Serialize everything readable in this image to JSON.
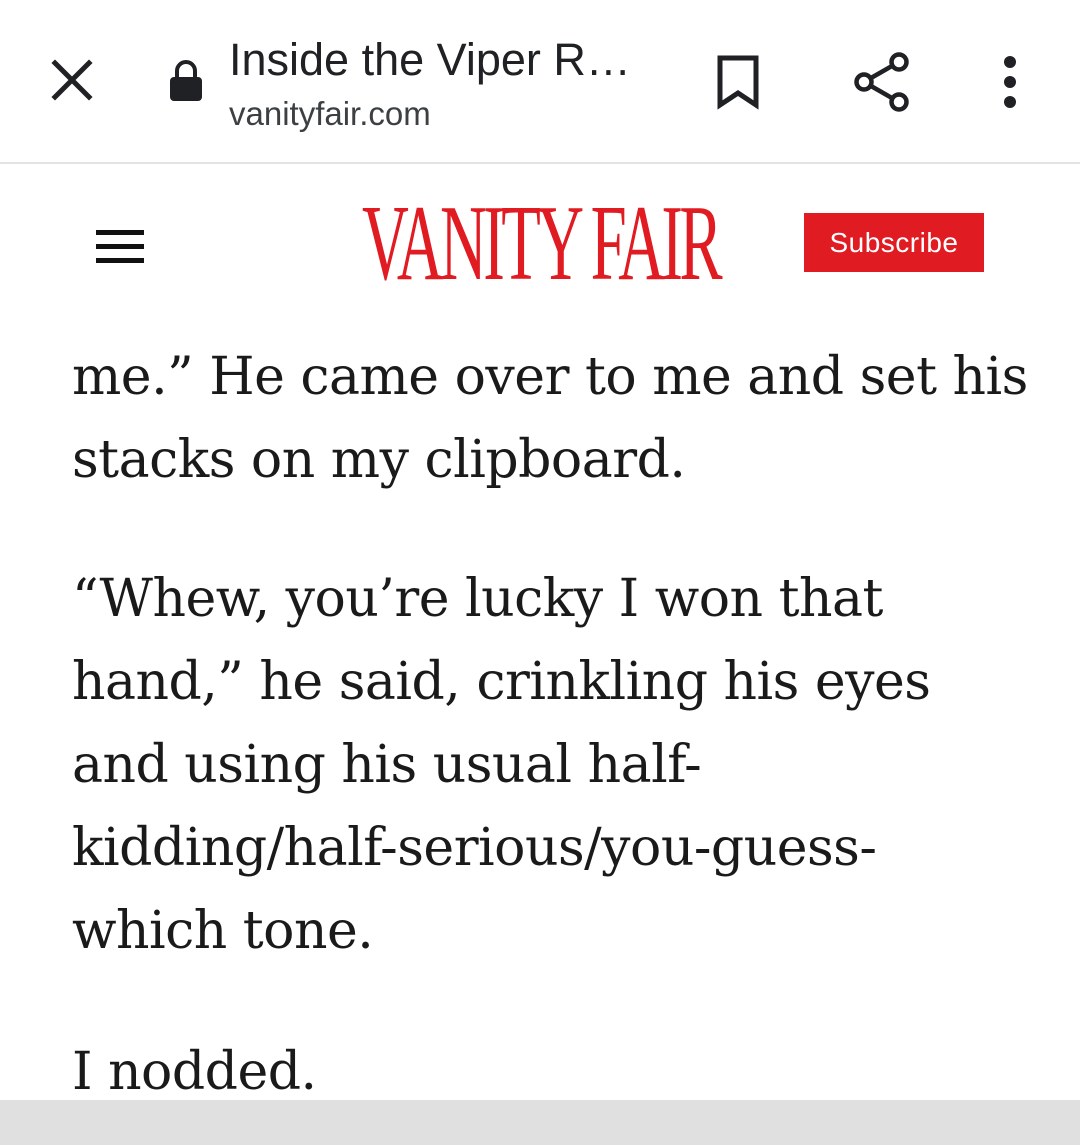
{
  "browser": {
    "page_title": "Inside the Viper R…",
    "domain": "vanityfair.com",
    "icons": {
      "close": "close-icon",
      "lock": "lock-icon",
      "bookmark": "bookmark-icon",
      "share": "share-icon",
      "more": "more-vert-icon"
    }
  },
  "site_header": {
    "logo_text": "VANITY FAIR",
    "subscribe_label": "Subscribe",
    "menu_icon": "hamburger-menu-icon",
    "brand_color": "#e01b22"
  },
  "article": {
    "paragraphs": [
      "me.” He came over to me and set his stacks on my clipboard.",
      "“Whew, you’re lucky I won that hand,” he said, crinkling his eyes and using his usual half-kidding/half-serious/you-guess-which tone.",
      "I nodded."
    ]
  }
}
